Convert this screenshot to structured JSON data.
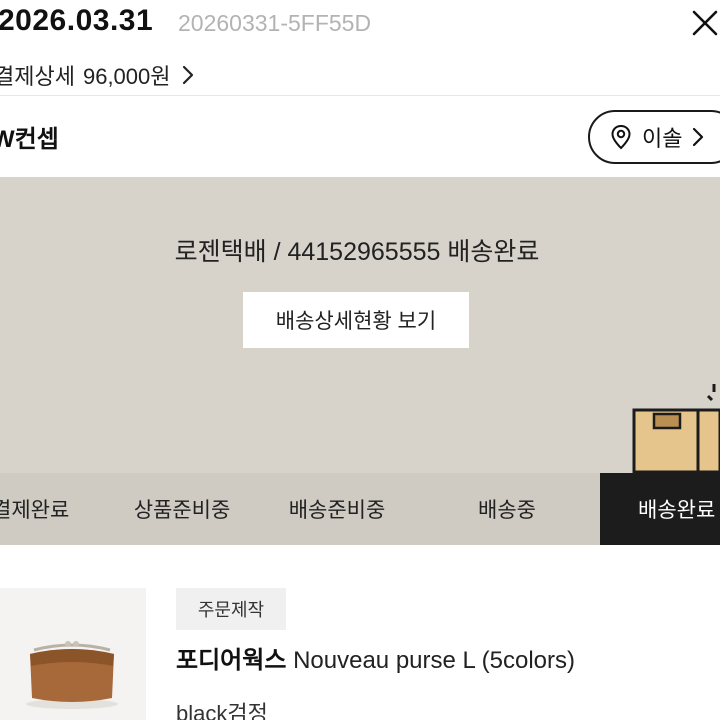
{
  "header": {
    "order_date": "2026.03.31",
    "order_number": "20260331-5FF55D",
    "payment_label": "결제상세",
    "payment_amount": "96,000원"
  },
  "shop": {
    "name": "W컨셉",
    "move_label": "이솔"
  },
  "delivery": {
    "carrier_line": "로젠택배 / 44152965555 배송완료",
    "detail_button": "배송상세현황 보기",
    "steps": [
      {
        "label": "결제완료"
      },
      {
        "label": "상품준비중"
      },
      {
        "label": "배송준비중"
      },
      {
        "label": "배송중"
      },
      {
        "label": "배송완료"
      }
    ],
    "active_step": "배송완료"
  },
  "product": {
    "badge": "주문제작",
    "brand": "포디어웍스",
    "name": "Nouveau purse L (5colors)",
    "option": "black검정"
  },
  "colors": {
    "banner_bg": "#d7d3cb",
    "steps_bg": "#cfcbc2",
    "active_step_bg": "#1c1c1c",
    "order_number_color": "#b3b3b3"
  },
  "icons": [
    "close-icon",
    "chevron-right-icon",
    "location-pin-icon",
    "box-icon"
  ]
}
